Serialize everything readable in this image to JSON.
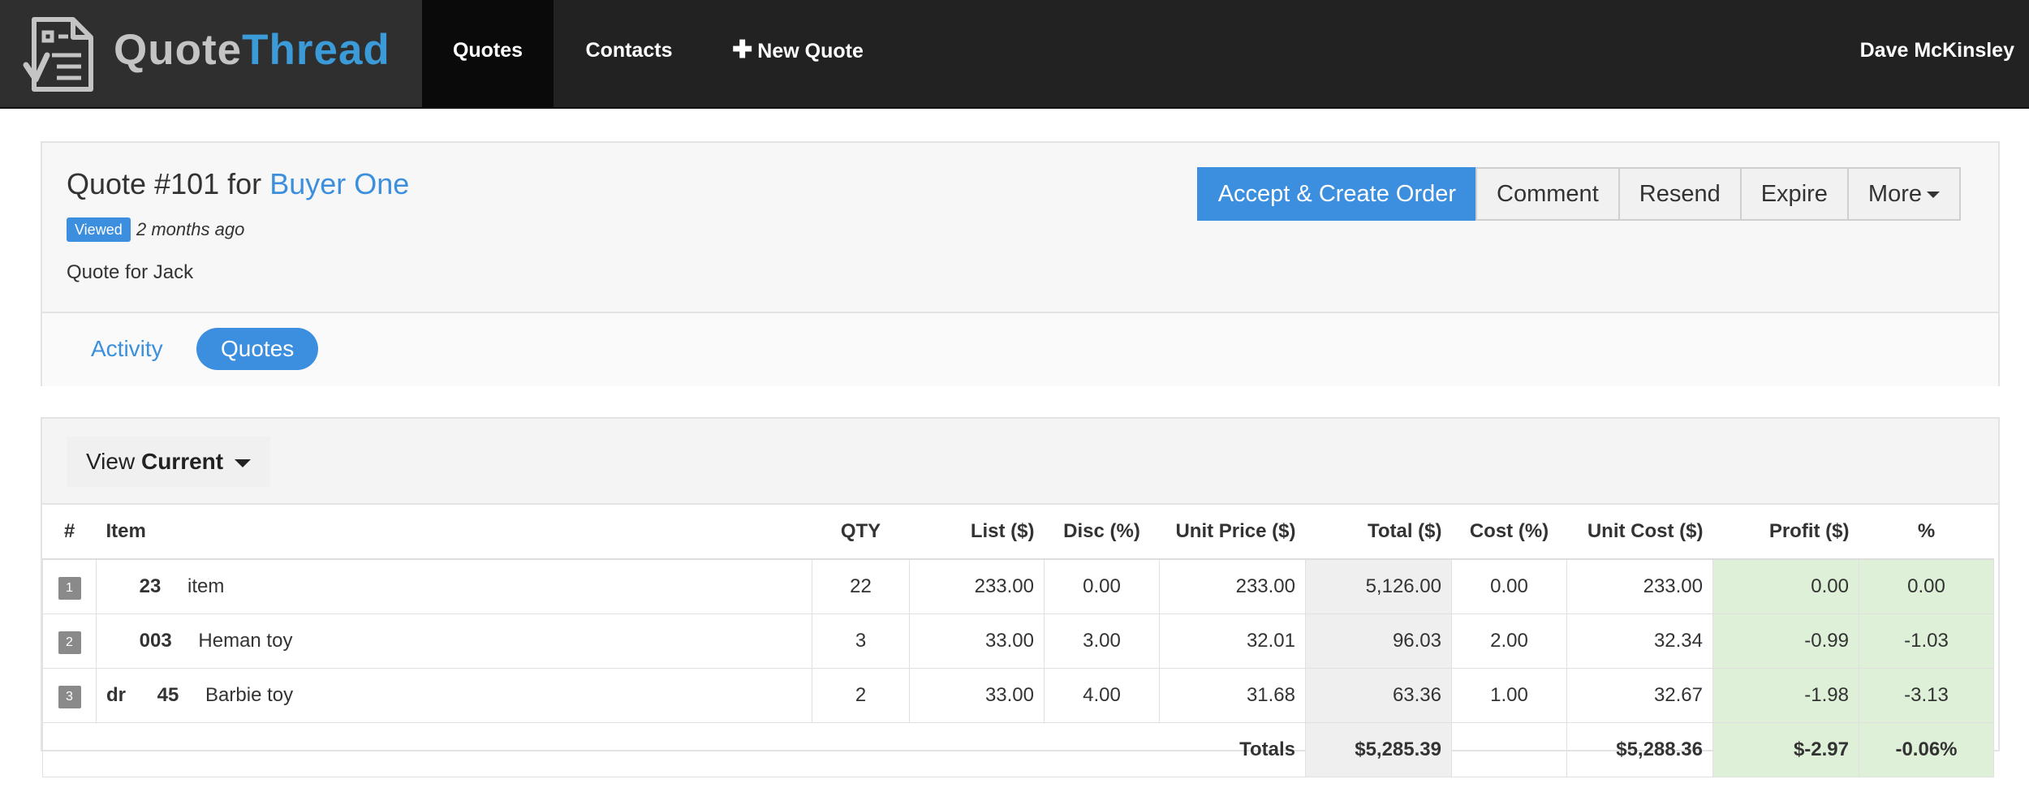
{
  "navbar": {
    "brand_part1": "Quote",
    "brand_part2": "Thread",
    "items": [
      "Quotes",
      "Contacts",
      "New Quote"
    ],
    "user": "Dave McKinsley"
  },
  "quote": {
    "title_prefix": "Quote #101 for",
    "buyer": "Buyer One",
    "badge": "Viewed",
    "age": "2 months ago",
    "description": "Quote for Jack",
    "actions": [
      "Accept & Create Order",
      "Comment",
      "Resend",
      "Expire",
      "More"
    ]
  },
  "tabs": [
    "Activity",
    "Quotes"
  ],
  "view": {
    "label": "View",
    "value": "Current"
  },
  "table": {
    "headers": [
      "#",
      "Item",
      "QTY",
      "List ($)",
      "Disc (%)",
      "Unit Price ($)",
      "Total ($)",
      "Cost (%)",
      "Unit Cost ($)",
      "Profit ($)",
      "%"
    ],
    "rows": [
      {
        "num": "1",
        "prefix": "",
        "code": "23",
        "name": "item",
        "qty": "22",
        "list": "233.00",
        "disc": "0.00",
        "unit_price": "233.00",
        "total": "5,126.00",
        "cost": "0.00",
        "unit_cost": "233.00",
        "profit": "0.00",
        "pct": "0.00"
      },
      {
        "num": "2",
        "prefix": "",
        "code": "003",
        "name": "Heman toy",
        "qty": "3",
        "list": "33.00",
        "disc": "3.00",
        "unit_price": "32.01",
        "total": "96.03",
        "cost": "2.00",
        "unit_cost": "32.34",
        "profit": "-0.99",
        "pct": "-1.03"
      },
      {
        "num": "3",
        "prefix": "dr",
        "code": "45",
        "name": "Barbie toy",
        "qty": "2",
        "list": "33.00",
        "disc": "4.00",
        "unit_price": "31.68",
        "total": "63.36",
        "cost": "1.00",
        "unit_cost": "32.67",
        "profit": "-1.98",
        "pct": "-3.13"
      }
    ],
    "totals": {
      "label": "Totals",
      "total": "$5,285.39",
      "unit_cost": "$5,288.36",
      "profit": "$-2.97",
      "pct": "-0.06%"
    }
  },
  "colors": {
    "nav_bg": "#222222",
    "accent": "#3c8fde",
    "profit_bg": "#def0d8"
  }
}
